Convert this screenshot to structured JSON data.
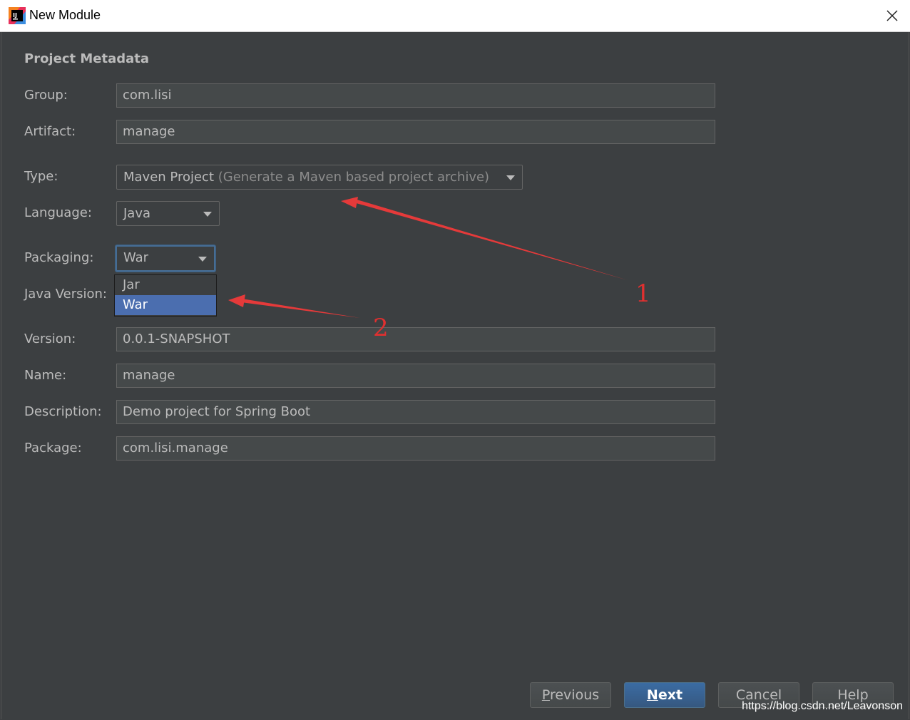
{
  "window": {
    "title": "New Module",
    "app_icon": "intellij-icon",
    "close_icon": "close-icon"
  },
  "section": {
    "title": "Project Metadata"
  },
  "fields": {
    "group": {
      "label": "Group:",
      "value": "com.lisi"
    },
    "artifact": {
      "label": "Artifact:",
      "value": "manage"
    },
    "type": {
      "label": "Type:",
      "value": "Maven Project",
      "hint": "(Generate a Maven based project archive)"
    },
    "language": {
      "label": "Language:",
      "value": "Java"
    },
    "packaging": {
      "label": "Packaging:",
      "value": "War",
      "options": [
        "Jar",
        "War"
      ],
      "selected_index": 1
    },
    "java_version": {
      "label": "Java Version:"
    },
    "version": {
      "label": "Version:",
      "value": "0.0.1-SNAPSHOT"
    },
    "name": {
      "label": "Name:",
      "value": "manage"
    },
    "description": {
      "label": "Description:",
      "value": "Demo project for Spring Boot"
    },
    "package": {
      "label": "Package:",
      "value": "com.lisi.manage"
    }
  },
  "buttons": {
    "previous": {
      "mnemonic": "P",
      "rest": "revious"
    },
    "next": {
      "mnemonic": "N",
      "rest": "ext"
    },
    "cancel": {
      "mnemonic": "",
      "rest": "Cancel"
    },
    "help": {
      "mnemonic": "",
      "rest": "Help"
    }
  },
  "annotations": {
    "arrow1_label": "1",
    "arrow2_label": "2",
    "color": "#e03030"
  },
  "watermark": "https://blog.csdn.net/Leavonson",
  "colors": {
    "background": "#3c3f41",
    "selection": "#4b6eaf",
    "primary_button": "#365880"
  }
}
